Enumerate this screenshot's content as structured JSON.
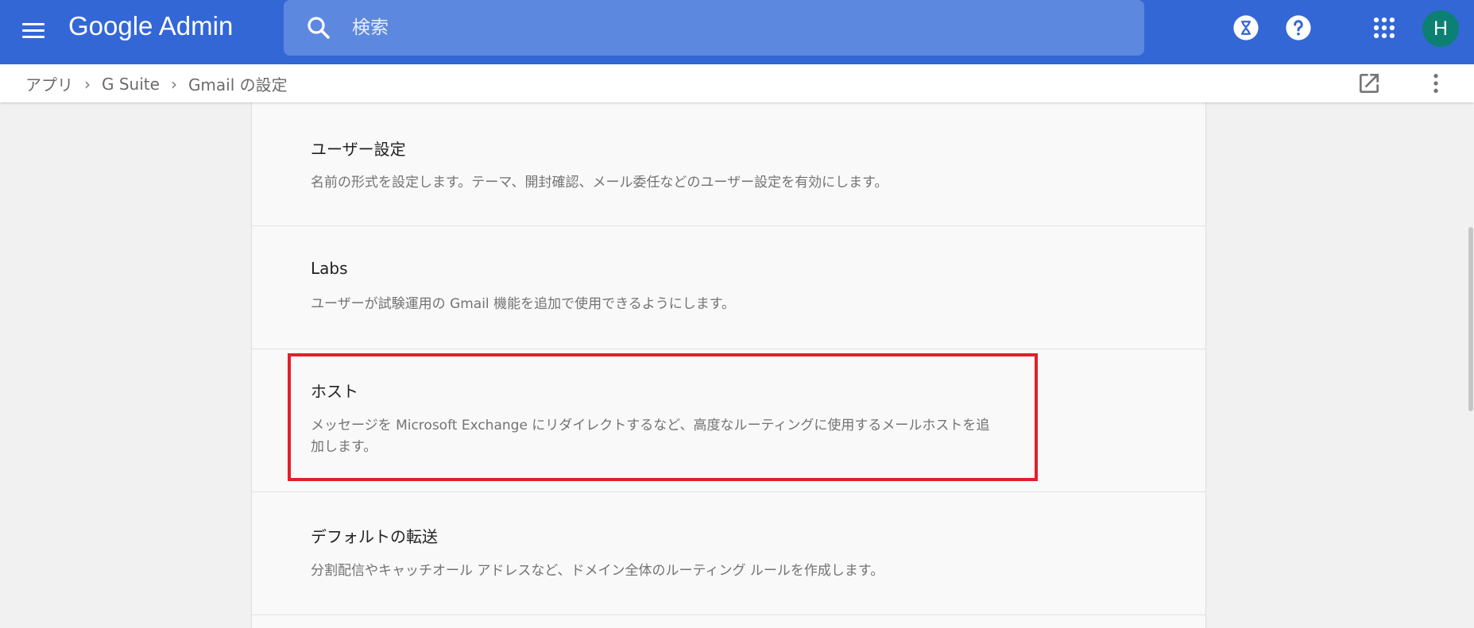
{
  "header": {
    "logo_text": "Google Admin",
    "search_placeholder": "検索",
    "avatar_initial": "H",
    "brand_color": "#3367d6"
  },
  "breadcrumb": [
    "アプリ",
    "G Suite",
    "Gmail の設定"
  ],
  "sections": [
    {
      "title": "ユーザー設定",
      "description": "名前の形式を設定します。テーマ、開封確認、メール委任などのユーザー設定を有効にします。"
    },
    {
      "title": "Labs",
      "description": "ユーザーが試験運用の Gmail 機能を追加で使用できるようにします。"
    },
    {
      "title": "ホスト",
      "description": "メッセージを Microsoft Exchange にリダイレクトするなど、高度なルーティングに使用するメールホストを追加します。"
    },
    {
      "title": "デフォルトの転送",
      "description": "分割配信やキャッチオール アドレスなど、ドメイン全体のルーティング ルールを作成します。"
    }
  ],
  "highlight_color": "#e0202a"
}
